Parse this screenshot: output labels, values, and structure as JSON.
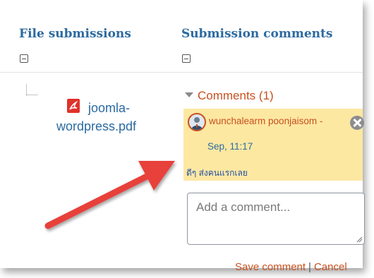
{
  "headers": {
    "file_submissions": "File submissions",
    "submission_comments": "Submission comments"
  },
  "file": {
    "name_line1": "joomla-",
    "name_line2": "wordpress.pdf",
    "icon": "pdf-icon"
  },
  "comments": {
    "toggle_label": "Comments (1)",
    "items": [
      {
        "author": "wunchalearm poonjaisom -",
        "date": "Sep, 11:17",
        "text": "ดีๆ ส่งคนแรกเลย"
      }
    ],
    "add_placeholder": "Add a comment...",
    "save_label": "Save comment",
    "separator": "|",
    "cancel_label": "Cancel"
  },
  "colors": {
    "header_blue": "#2c6aa0",
    "accent_orange": "#c8501f",
    "comment_bg": "#fde8a2",
    "arrow_red": "#e8413a"
  }
}
